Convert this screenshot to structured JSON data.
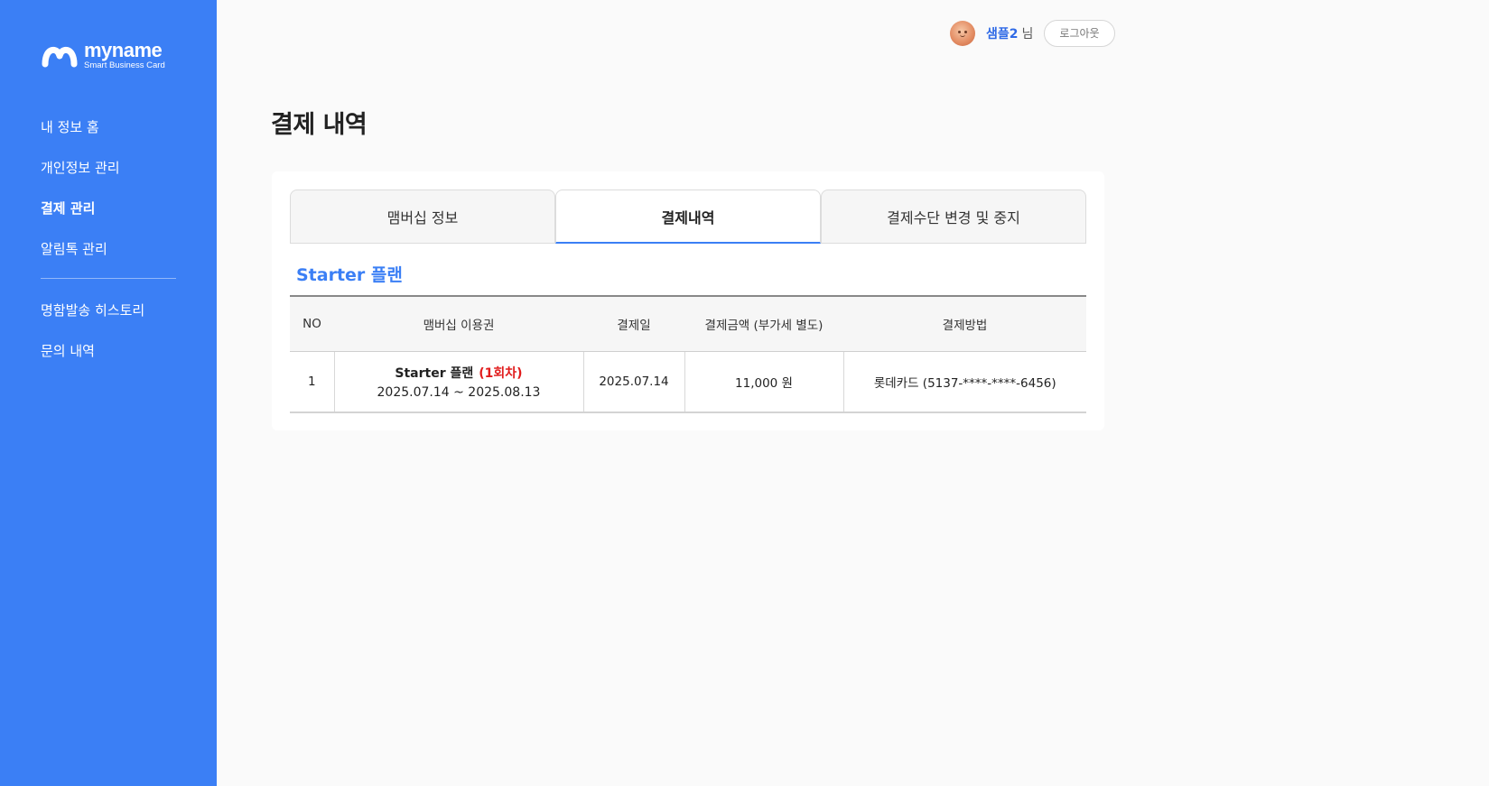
{
  "brand": {
    "name": "myname",
    "tagline": "Smart Business Card",
    "accent": "#3b7ff5"
  },
  "sidebar": {
    "items": [
      {
        "label": "내 정보 홈"
      },
      {
        "label": "개인정보 관리"
      },
      {
        "label": "결제 관리",
        "active": true
      },
      {
        "label": "알림톡 관리"
      },
      {
        "label": "명함발송 히스토리"
      },
      {
        "label": "문의 내역"
      }
    ]
  },
  "header": {
    "user_name": "샘플2",
    "user_suffix": "님",
    "logout_label": "로그아웃"
  },
  "page": {
    "title": "결제 내역"
  },
  "tabs": [
    {
      "label": "맴버십 정보"
    },
    {
      "label": "결제내역",
      "active": true
    },
    {
      "label": "결제수단 변경 및 중지"
    }
  ],
  "plan_title": "Starter 플랜",
  "table": {
    "headers": [
      "NO",
      "맴버십 이용권",
      "결제일",
      "결제금액 (부가세 별도)",
      "결제방법"
    ],
    "rows": [
      {
        "no": "1",
        "plan": "Starter 플랜",
        "round": "(1회차)",
        "period": "2025.07.14 ~ 2025.08.13",
        "date": "2025.07.14",
        "amount": "11,000 원",
        "method": "롯데카드 (5137-****-****-6456)"
      }
    ]
  }
}
